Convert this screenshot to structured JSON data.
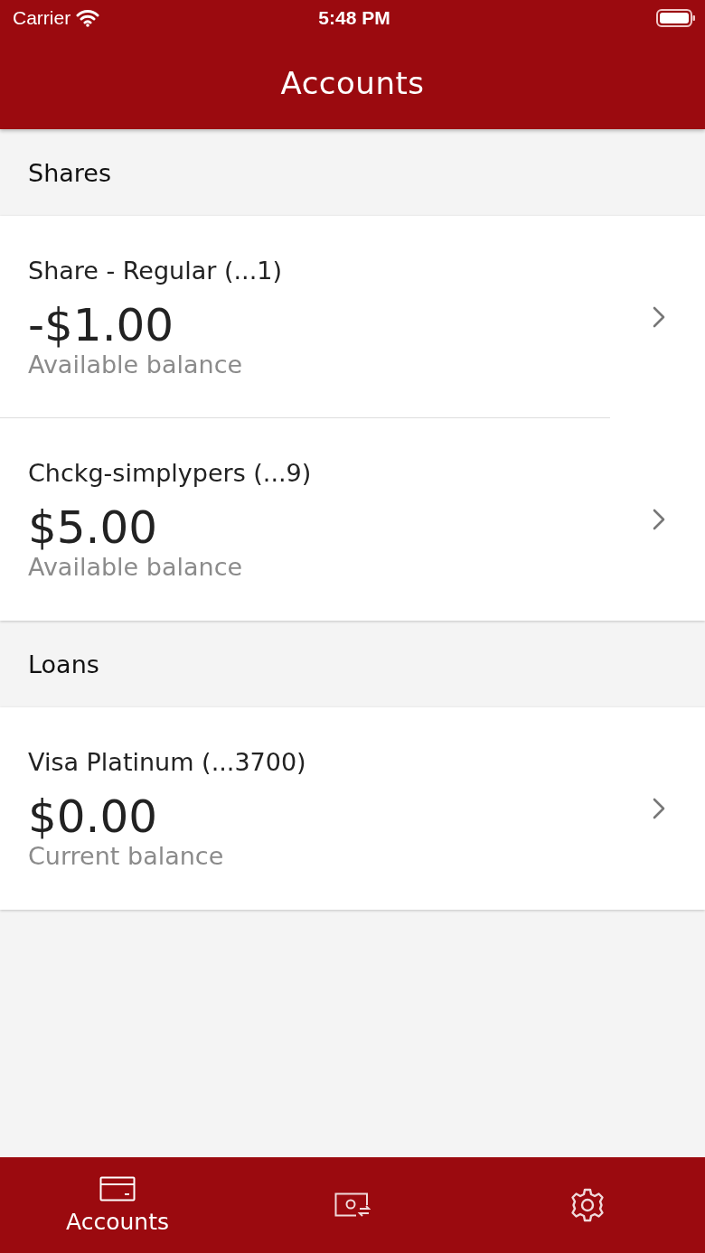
{
  "status_bar": {
    "carrier": "Carrier",
    "time": "5:48 PM"
  },
  "header": {
    "title": "Accounts"
  },
  "sections": [
    {
      "title": "Shares",
      "accounts": [
        {
          "name": "Share - Regular (...1)",
          "amount": "-$1.00",
          "caption": "Available balance"
        },
        {
          "name": "Chckg-simplypers (...9)",
          "amount": "$5.00",
          "caption": "Available balance"
        }
      ]
    },
    {
      "title": "Loans",
      "accounts": [
        {
          "name": "Visa Platinum (...3700)",
          "amount": "$0.00",
          "caption": "Current balance"
        }
      ]
    }
  ],
  "tab_bar": [
    {
      "kind": "card",
      "label": "Accounts",
      "selected": true
    },
    {
      "kind": "transfer",
      "selected": false
    },
    {
      "kind": "settings",
      "selected": false
    }
  ]
}
